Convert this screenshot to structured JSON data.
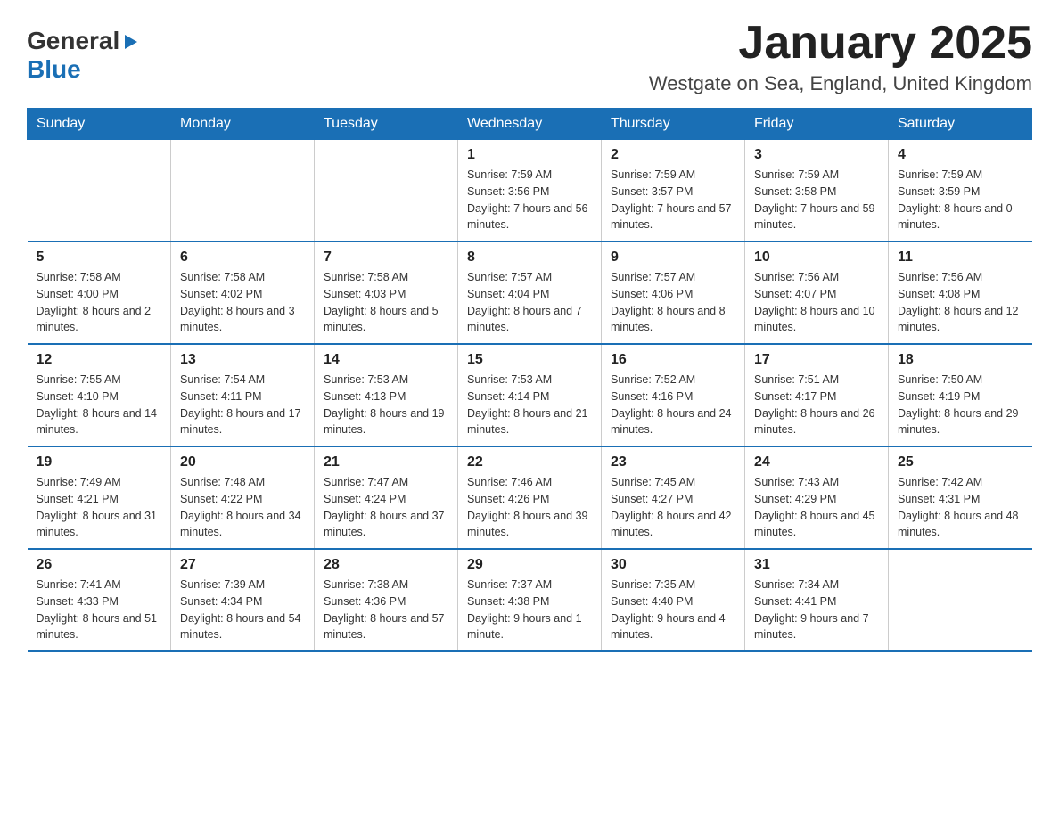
{
  "logo": {
    "general": "General",
    "blue": "Blue",
    "arrow": "▶"
  },
  "header": {
    "title": "January 2025",
    "subtitle": "Westgate on Sea, England, United Kingdom"
  },
  "days_of_week": [
    "Sunday",
    "Monday",
    "Tuesday",
    "Wednesday",
    "Thursday",
    "Friday",
    "Saturday"
  ],
  "weeks": [
    [
      {
        "day": "",
        "info": ""
      },
      {
        "day": "",
        "info": ""
      },
      {
        "day": "",
        "info": ""
      },
      {
        "day": "1",
        "info": "Sunrise: 7:59 AM\nSunset: 3:56 PM\nDaylight: 7 hours\nand 56 minutes."
      },
      {
        "day": "2",
        "info": "Sunrise: 7:59 AM\nSunset: 3:57 PM\nDaylight: 7 hours\nand 57 minutes."
      },
      {
        "day": "3",
        "info": "Sunrise: 7:59 AM\nSunset: 3:58 PM\nDaylight: 7 hours\nand 59 minutes."
      },
      {
        "day": "4",
        "info": "Sunrise: 7:59 AM\nSunset: 3:59 PM\nDaylight: 8 hours\nand 0 minutes."
      }
    ],
    [
      {
        "day": "5",
        "info": "Sunrise: 7:58 AM\nSunset: 4:00 PM\nDaylight: 8 hours\nand 2 minutes."
      },
      {
        "day": "6",
        "info": "Sunrise: 7:58 AM\nSunset: 4:02 PM\nDaylight: 8 hours\nand 3 minutes."
      },
      {
        "day": "7",
        "info": "Sunrise: 7:58 AM\nSunset: 4:03 PM\nDaylight: 8 hours\nand 5 minutes."
      },
      {
        "day": "8",
        "info": "Sunrise: 7:57 AM\nSunset: 4:04 PM\nDaylight: 8 hours\nand 7 minutes."
      },
      {
        "day": "9",
        "info": "Sunrise: 7:57 AM\nSunset: 4:06 PM\nDaylight: 8 hours\nand 8 minutes."
      },
      {
        "day": "10",
        "info": "Sunrise: 7:56 AM\nSunset: 4:07 PM\nDaylight: 8 hours\nand 10 minutes."
      },
      {
        "day": "11",
        "info": "Sunrise: 7:56 AM\nSunset: 4:08 PM\nDaylight: 8 hours\nand 12 minutes."
      }
    ],
    [
      {
        "day": "12",
        "info": "Sunrise: 7:55 AM\nSunset: 4:10 PM\nDaylight: 8 hours\nand 14 minutes."
      },
      {
        "day": "13",
        "info": "Sunrise: 7:54 AM\nSunset: 4:11 PM\nDaylight: 8 hours\nand 17 minutes."
      },
      {
        "day": "14",
        "info": "Sunrise: 7:53 AM\nSunset: 4:13 PM\nDaylight: 8 hours\nand 19 minutes."
      },
      {
        "day": "15",
        "info": "Sunrise: 7:53 AM\nSunset: 4:14 PM\nDaylight: 8 hours\nand 21 minutes."
      },
      {
        "day": "16",
        "info": "Sunrise: 7:52 AM\nSunset: 4:16 PM\nDaylight: 8 hours\nand 24 minutes."
      },
      {
        "day": "17",
        "info": "Sunrise: 7:51 AM\nSunset: 4:17 PM\nDaylight: 8 hours\nand 26 minutes."
      },
      {
        "day": "18",
        "info": "Sunrise: 7:50 AM\nSunset: 4:19 PM\nDaylight: 8 hours\nand 29 minutes."
      }
    ],
    [
      {
        "day": "19",
        "info": "Sunrise: 7:49 AM\nSunset: 4:21 PM\nDaylight: 8 hours\nand 31 minutes."
      },
      {
        "day": "20",
        "info": "Sunrise: 7:48 AM\nSunset: 4:22 PM\nDaylight: 8 hours\nand 34 minutes."
      },
      {
        "day": "21",
        "info": "Sunrise: 7:47 AM\nSunset: 4:24 PM\nDaylight: 8 hours\nand 37 minutes."
      },
      {
        "day": "22",
        "info": "Sunrise: 7:46 AM\nSunset: 4:26 PM\nDaylight: 8 hours\nand 39 minutes."
      },
      {
        "day": "23",
        "info": "Sunrise: 7:45 AM\nSunset: 4:27 PM\nDaylight: 8 hours\nand 42 minutes."
      },
      {
        "day": "24",
        "info": "Sunrise: 7:43 AM\nSunset: 4:29 PM\nDaylight: 8 hours\nand 45 minutes."
      },
      {
        "day": "25",
        "info": "Sunrise: 7:42 AM\nSunset: 4:31 PM\nDaylight: 8 hours\nand 48 minutes."
      }
    ],
    [
      {
        "day": "26",
        "info": "Sunrise: 7:41 AM\nSunset: 4:33 PM\nDaylight: 8 hours\nand 51 minutes."
      },
      {
        "day": "27",
        "info": "Sunrise: 7:39 AM\nSunset: 4:34 PM\nDaylight: 8 hours\nand 54 minutes."
      },
      {
        "day": "28",
        "info": "Sunrise: 7:38 AM\nSunset: 4:36 PM\nDaylight: 8 hours\nand 57 minutes."
      },
      {
        "day": "29",
        "info": "Sunrise: 7:37 AM\nSunset: 4:38 PM\nDaylight: 9 hours\nand 1 minute."
      },
      {
        "day": "30",
        "info": "Sunrise: 7:35 AM\nSunset: 4:40 PM\nDaylight: 9 hours\nand 4 minutes."
      },
      {
        "day": "31",
        "info": "Sunrise: 7:34 AM\nSunset: 4:41 PM\nDaylight: 9 hours\nand 7 minutes."
      },
      {
        "day": "",
        "info": ""
      }
    ]
  ]
}
